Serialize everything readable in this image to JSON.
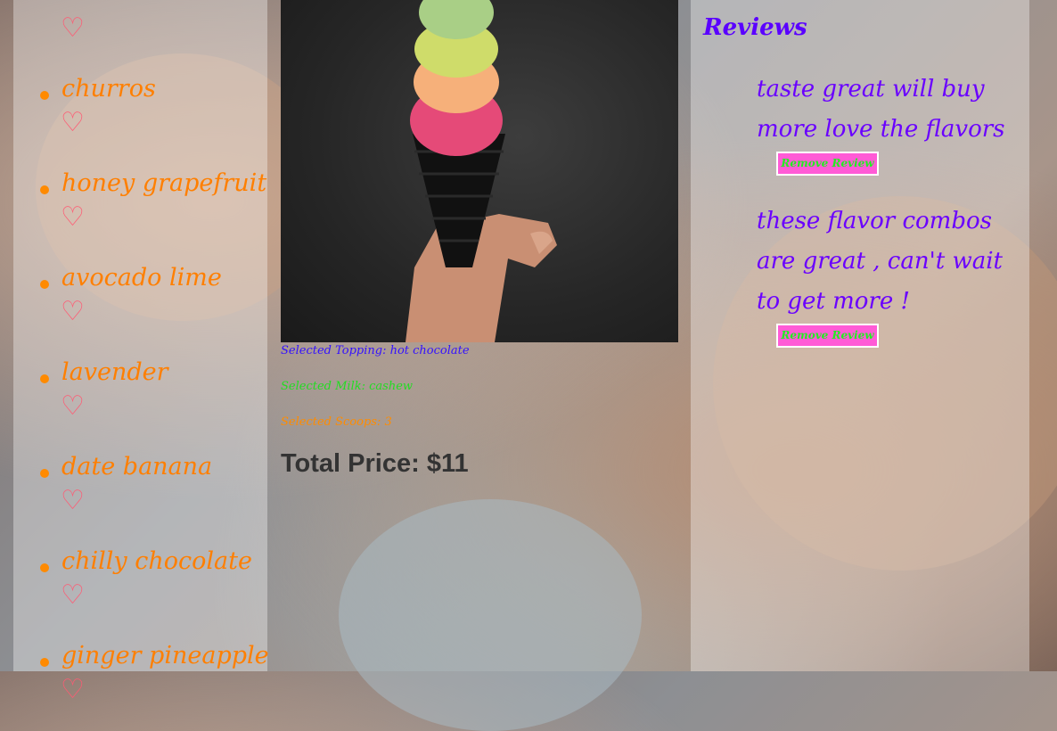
{
  "flavors": [
    {
      "name": "",
      "heart": "♡"
    },
    {
      "name": "churros",
      "heart": "♡"
    },
    {
      "name": "honey grapefruit",
      "heart": "♡"
    },
    {
      "name": "avocado lime",
      "heart": "♡"
    },
    {
      "name": "lavender",
      "heart": "♡"
    },
    {
      "name": "date banana",
      "heart": "♡"
    },
    {
      "name": "chilly chocolate",
      "heart": "♡"
    },
    {
      "name": "ginger pineapple",
      "heart": "♡"
    }
  ],
  "order": {
    "selected_topping": "Selected Topping: hot chocolate",
    "selected_milk": "Selected Milk: cashew",
    "selected_scoops": "Selected Scoops: 3",
    "total_price": "Total Price: $11"
  },
  "reviews": {
    "title": "Reviews",
    "items": [
      {
        "text": "taste great will buy more love the flavors",
        "remove_label": "Remove Review"
      },
      {
        "text": "these flavor combos are great , can't wait to get more !",
        "remove_label": "Remove Review"
      }
    ]
  },
  "colors": {
    "flavor_text": "#ff7f00",
    "heart": "#ff5a73",
    "review_text": "#6a00ff",
    "topping_text": "#3311ff",
    "milk_text": "#22dd22",
    "scoops_text": "#ff8c00",
    "remove_button_bg": "#ff5bd6",
    "remove_button_text": "#22ee22"
  }
}
